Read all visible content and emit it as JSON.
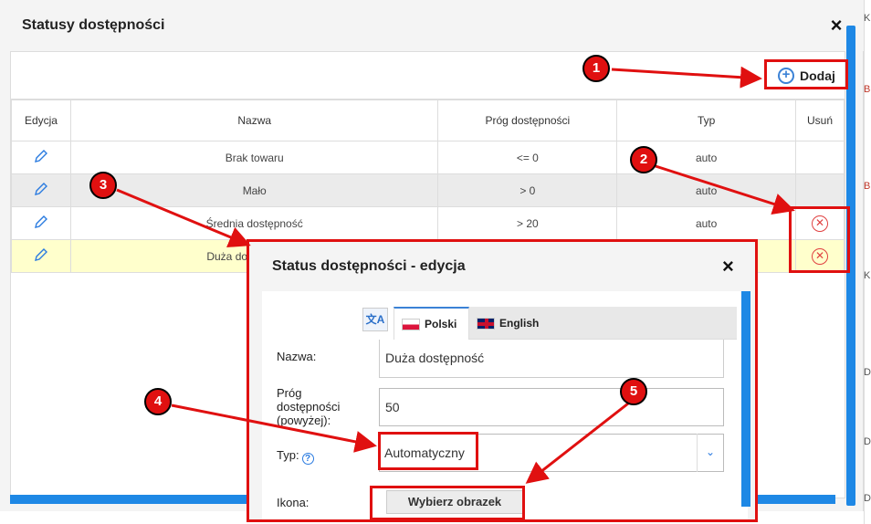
{
  "dialog": {
    "title": "Statusy dostępności",
    "close_icon": "×",
    "add_label": "Dodaj",
    "columns": [
      "Edycja",
      "Nazwa",
      "Próg dostępności",
      "Typ",
      "Usuń"
    ],
    "rows": [
      {
        "name": "Brak towaru",
        "threshold": "<= 0",
        "type": "auto"
      },
      {
        "name": "Mało",
        "threshold": "> 0",
        "type": "auto"
      },
      {
        "name": "Średnia dostępność",
        "threshold": "> 20",
        "type": "auto"
      },
      {
        "name": "Duża do",
        "threshold": "",
        "type": ""
      }
    ]
  },
  "background": {
    "fragments": [
      "K",
      "B",
      "B",
      "K",
      "D",
      "D",
      "D"
    ]
  },
  "edit_dialog": {
    "title": "Status dostępności - edycja",
    "close_icon": "×",
    "tabs": [
      "Polski",
      "English"
    ],
    "name_label": "Nazwa:",
    "name_value": "Duża dostępność",
    "threshold_label_1": "Próg",
    "threshold_label_2": "dostępności",
    "threshold_label_3": "(powyżej):",
    "threshold_value": "50",
    "type_label": "Typ:",
    "type_value": "Automatyczny",
    "icon_label": "Ikona:",
    "pick_button": "Wybierz obrazek"
  },
  "annotations": [
    "1",
    "2",
    "3",
    "4",
    "5"
  ],
  "colors": {
    "accent": "#1e88e5",
    "annotation": "#e01010",
    "highlight_row": "#ffffcc"
  }
}
